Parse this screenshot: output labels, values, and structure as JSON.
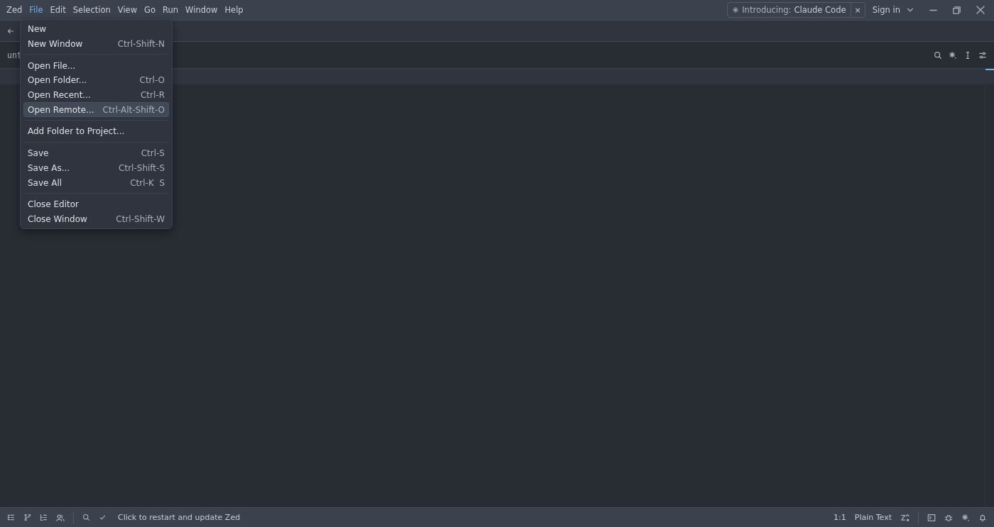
{
  "menu_bar": {
    "items": [
      {
        "label": "Zed",
        "selected": false
      },
      {
        "label": "File",
        "selected": true
      },
      {
        "label": "Edit",
        "selected": false
      },
      {
        "label": "Selection",
        "selected": false
      },
      {
        "label": "View",
        "selected": false
      },
      {
        "label": "Go",
        "selected": false
      },
      {
        "label": "Run",
        "selected": false
      },
      {
        "label": "Window",
        "selected": false
      },
      {
        "label": "Help",
        "selected": false
      }
    ]
  },
  "banner": {
    "prefix": "Introducing:",
    "label": "Claude Code",
    "close": "×"
  },
  "sign_in": "Sign in",
  "breadcrumb": "unt",
  "file_menu": {
    "groups": [
      {
        "items": [
          {
            "label": "New",
            "selected": false
          },
          {
            "label": "New Window",
            "shortcut": "Ctrl-Shift-N",
            "selected": false
          }
        ]
      },
      {
        "items": [
          {
            "label": "Open File...",
            "selected": false
          },
          {
            "label": "Open Folder...",
            "shortcut": "Ctrl-O",
            "selected": false
          },
          {
            "label": "Open Recent...",
            "shortcut": "Ctrl-R",
            "selected": false
          },
          {
            "label": "Open Remote...",
            "shortcut": "Ctrl-Alt-Shift-O",
            "selected": true
          }
        ]
      },
      {
        "items": [
          {
            "label": "Add Folder to Project...",
            "selected": false
          }
        ]
      },
      {
        "items": [
          {
            "label": "Save",
            "shortcut": "Ctrl-S",
            "selected": false
          },
          {
            "label": "Save As...",
            "shortcut": "Ctrl-Shift-S",
            "selected": false
          },
          {
            "label": "Save All",
            "shortcut": "Ctrl-K  S",
            "selected": false
          }
        ]
      },
      {
        "items": [
          {
            "label": "Close Editor",
            "selected": false
          },
          {
            "label": "Close Window",
            "shortcut": "Ctrl-Shift-W",
            "selected": false
          }
        ]
      }
    ]
  },
  "status_bar": {
    "message": "Click to restart and update Zed",
    "cursor": "1:1",
    "language": "Plain Text"
  }
}
